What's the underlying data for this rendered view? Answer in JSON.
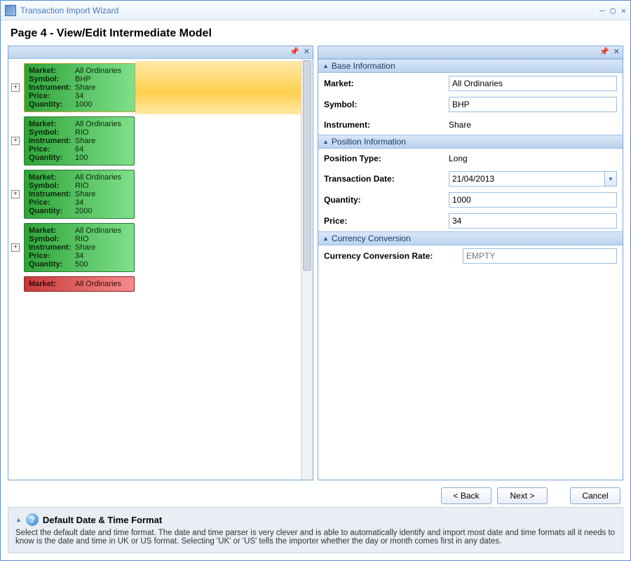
{
  "window": {
    "title": "Transaction Import Wizard"
  },
  "page_title": "Page 4 - View/Edit Intermediate Model",
  "cards": [
    {
      "selected": true,
      "color": "green",
      "market": "All Ordinaries",
      "symbol": "BHP",
      "instrument": "Share",
      "price": "34",
      "quantity": "1000"
    },
    {
      "selected": false,
      "color": "green",
      "market": "All Ordinaries",
      "symbol": "RIO",
      "instrument": "Share",
      "price": "64",
      "quantity": "100"
    },
    {
      "selected": false,
      "color": "green",
      "market": "All Ordinaries",
      "symbol": "RIO",
      "instrument": "Share",
      "price": "34",
      "quantity": "2000"
    },
    {
      "selected": false,
      "color": "green",
      "market": "All Ordinaries",
      "symbol": "RIO",
      "instrument": "Share",
      "price": "34",
      "quantity": "500"
    },
    {
      "selected": false,
      "color": "red",
      "market": "All Ordinaries",
      "symbol": "",
      "instrument": "",
      "price": "",
      "quantity": "",
      "partial": true
    }
  ],
  "card_labels": {
    "market": "Market:",
    "symbol": "Symbol:",
    "instrument": "Instrument:",
    "price": "Price:",
    "quantity": "Quantity:"
  },
  "groups": {
    "base": "Base Information",
    "position": "Position Information",
    "currency": "Currency Conversion"
  },
  "props": {
    "market_label": "Market:",
    "market_value": "All Ordinaries",
    "symbol_label": "Symbol:",
    "symbol_value": "BHP",
    "instrument_label": "Instrument:",
    "instrument_value": "Share",
    "ptype_label": "Position Type:",
    "ptype_value": "Long",
    "tdate_label": "Transaction Date:",
    "tdate_value": "21/04/2013",
    "qty_label": "Quantity:",
    "qty_value": "1000",
    "price_label": "Price:",
    "price_value": "34",
    "ccr_label": "Currency Conversion Rate:",
    "ccr_placeholder": "EMPTY"
  },
  "buttons": {
    "back": "< Back",
    "next": "Next >",
    "cancel": "Cancel"
  },
  "help": {
    "title": "Default Date & Time Format",
    "body": "Select the default date and time format. The date and time parser is very clever and is able to automatically identify and import most date and time formats all it needs to know is the date and time in UK or US format. Selecting 'UK' or 'US' tells the importer whether the day or month comes first in any dates."
  }
}
